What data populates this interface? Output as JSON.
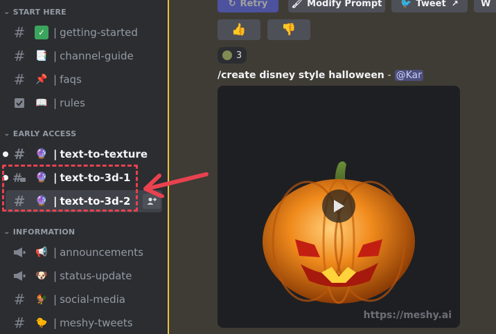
{
  "sidebar": {
    "sections": [
      {
        "label": "START HERE"
      },
      {
        "label": "EARLY ACCESS"
      },
      {
        "label": "INFORMATION"
      }
    ],
    "channels": [
      {
        "name": "getting-started",
        "emoji": "✅",
        "icon": "hash-icon"
      },
      {
        "name": "channel-guide",
        "emoji": "📑",
        "icon": "hash-icon"
      },
      {
        "name": "faqs",
        "emoji": "📌",
        "icon": "hash-icon"
      },
      {
        "name": "rules",
        "emoji": "📖",
        "icon": "rules-check-icon"
      },
      {
        "name": "text-to-texture",
        "emoji": "🔮",
        "icon": "hash-icon"
      },
      {
        "name": "text-to-3d-1",
        "emoji": "🔮",
        "icon": "thread-hash-icon"
      },
      {
        "name": "text-to-3d-2",
        "emoji": "🔮",
        "icon": "hash-icon"
      },
      {
        "name": "announcements",
        "emoji": "📢",
        "icon": "megaphone-icon"
      },
      {
        "name": "status-update",
        "emoji": "🐶",
        "icon": "megaphone-icon"
      },
      {
        "name": "social-media",
        "emoji": "🐓",
        "icon": "hash-icon"
      },
      {
        "name": "meshy-tweets",
        "emoji": "🐤",
        "icon": "hash-icon"
      }
    ],
    "separator": "|"
  },
  "main": {
    "buttons": {
      "retry": "Retry",
      "modify_prompt": "Modify Prompt",
      "tweet": "Tweet",
      "more": "W"
    },
    "reaction": {
      "count": "3"
    },
    "message": {
      "text": "/create disney style halloween",
      "separator": "-",
      "mention": "@Kar"
    },
    "watermark": "https://meshy.ai"
  },
  "colors": {
    "annotation": "#e8424f",
    "sidebar_border": "#e8c23a",
    "accent": "#5865f2"
  }
}
